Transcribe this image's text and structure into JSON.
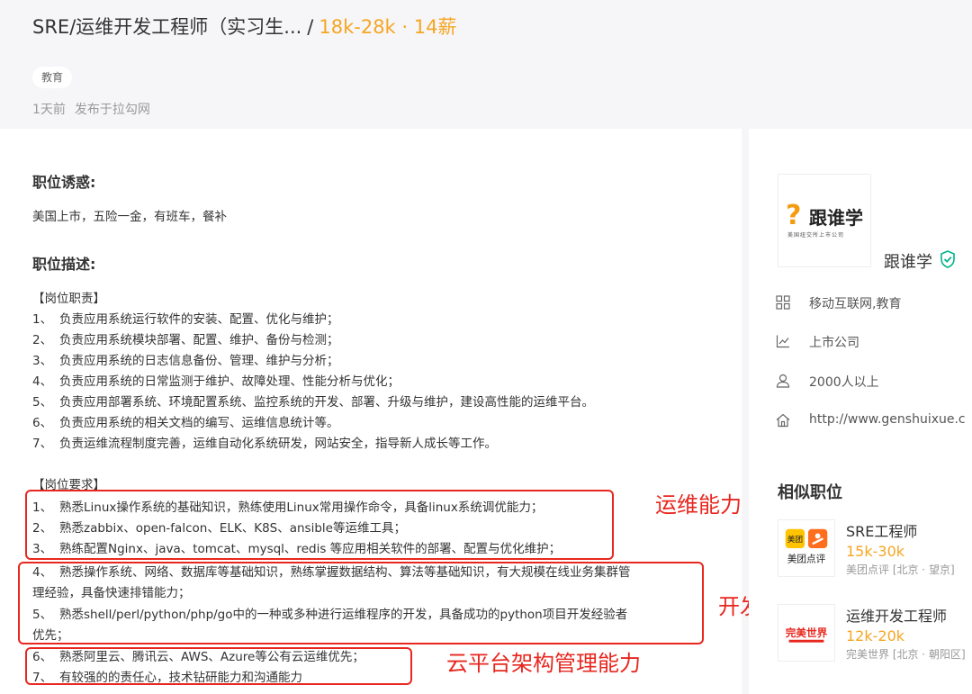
{
  "header": {
    "job_title": "SRE/运维开发工程师（实习生...",
    "separator": "/",
    "salary": "18k-28k · 14薪",
    "tag": "教育",
    "posted_time": "1天前",
    "posted_source": "发布于拉勾网"
  },
  "benefits": {
    "title": "职位诱惑:",
    "text": "美国上市，五险一金，有班车，餐补"
  },
  "description": {
    "title": "职位描述:",
    "duties_heading": "【岗位职责】",
    "duties": [
      {
        "num": "1、",
        "text": "负责应用系统运行软件的安装、配置、优化与维护；"
      },
      {
        "num": "2、",
        "text": "负责应用系统模块部署、配置、维护、备份与检测；"
      },
      {
        "num": "3、",
        "text": "负责应用系统的日志信息备份、管理、维护与分析；"
      },
      {
        "num": "4、",
        "text": "负责应用系统的日常监测于维护、故障处理、性能分析与优化；"
      },
      {
        "num": "5、",
        "text": "负责应用部署系统、环境配置系统、监控系统的开发、部署、升级与维护，建设高性能的运维平台。"
      },
      {
        "num": "6、",
        "text": "负责应用系统的相关文档的编写、运维信息统计等。"
      },
      {
        "num": "7、",
        "text": "负责运维流程制度完善，运维自动化系统研发，网站安全，指导新人成长等工作。"
      }
    ],
    "req_heading": "【岗位要求】",
    "requirements": [
      {
        "num": "1、",
        "text": "熟悉Linux操作系统的基础知识，熟练使用Linux常用操作命令，具备linux系统调优能力；"
      },
      {
        "num": "2、",
        "text": "熟悉zabbix、open-falcon、ELK、K8S、ansible等运维工具；"
      },
      {
        "num": "3、",
        "text": "熟练配置Nginx、java、tomcat、mysql、redis 等应用相关软件的部署、配置与优化维护；"
      },
      {
        "num": "4、",
        "text": "熟悉操作系统、网络、数据库等基础知识，熟练掌握数据结构、算法等基础知识，有大规模在线业务集群管"
      },
      {
        "num": "",
        "text": "理经验，具备快速排错能力；"
      },
      {
        "num": "5、",
        "text": "熟悉shell/perl/python/php/go中的一种或多种进行运维程序的开发，具备成功的python项目开发经验者"
      },
      {
        "num": "",
        "text": "优先；"
      },
      {
        "num": "6、",
        "text": "熟悉阿里云、腾讯云、AWS、Azure等公有云运维优先；"
      },
      {
        "num": "7、",
        "text": "有较强的的责任心，技术钻研能力和沟通能力"
      }
    ]
  },
  "annotations": {
    "ops": "运维能力",
    "dev": "开发能力",
    "cloud": "云平台架构管理能力"
  },
  "company": {
    "logo_name": "跟谁学",
    "logo_sub": "美国纽交所上市公司",
    "name": "跟谁学",
    "industry": "移动互联网,教育",
    "stage": "上市公司",
    "size": "2000人以上",
    "website": "http://www.genshuixue.c"
  },
  "similar": {
    "title": "相似职位",
    "jobs": [
      {
        "title": "SRE工程师",
        "salary": "15k-30k",
        "company": "美团点评 [北京 · 望京]",
        "logo": "美团点评"
      },
      {
        "title": "运维开发工程师",
        "salary": "12k-20k",
        "company": "完美世界 [北京 · 朝阳区]",
        "logo": "完美世界"
      }
    ]
  },
  "colors": {
    "salary": "#f5a623",
    "annotation": "#e8271f",
    "verified": "#00b38a"
  }
}
